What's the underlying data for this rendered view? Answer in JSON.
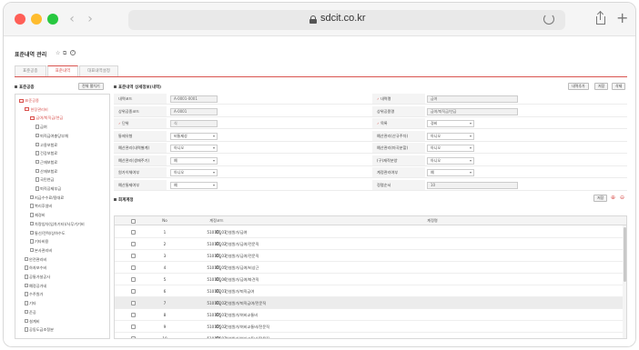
{
  "browser": {
    "url": "sdcit.co.kr",
    "back_glyph": "‹",
    "forward_glyph": "›",
    "new_tab_glyph": "+"
  },
  "page": {
    "title": "표준내역 관리",
    "star_icon": "☆",
    "open_icon": "⧉",
    "help_icon": "?",
    "tabs": [
      {
        "label": "표준공종",
        "active": false
      },
      {
        "label": "표준내역",
        "active": true
      },
      {
        "label": "대표내역설정",
        "active": false
      }
    ]
  },
  "left_panel": {
    "title": "표준공종",
    "expand_button": "전체 펼치기",
    "tree": [
      {
        "label": "표준공종",
        "level": 0,
        "type": "folder-open"
      },
      {
        "label": "현장관리비",
        "level": 1,
        "type": "folder-open"
      },
      {
        "label": "급여/퇴직금/연금",
        "level": 2,
        "type": "folder-open"
      },
      {
        "label": "급여",
        "level": 3,
        "type": "doc"
      },
      {
        "label": "퇴직급여충당부채",
        "level": 3,
        "type": "doc"
      },
      {
        "label": "고용보험료",
        "level": 3,
        "type": "doc"
      },
      {
        "label": "건강보험료",
        "level": 3,
        "type": "doc"
      },
      {
        "label": "근재보험료",
        "level": 3,
        "type": "doc"
      },
      {
        "label": "산재보험료",
        "level": 3,
        "type": "doc"
      },
      {
        "label": "국민연금",
        "level": 3,
        "type": "doc"
      },
      {
        "label": "퇴직공제부금",
        "level": 3,
        "type": "doc"
      },
      {
        "label": "지급수수료/용대료",
        "level": 2,
        "type": "doc"
      },
      {
        "label": "복리후생비",
        "level": 2,
        "type": "doc"
      },
      {
        "label": "제경비",
        "level": 2,
        "type": "doc"
      },
      {
        "label": "차량임차(임차기타)/사무기기비",
        "level": 2,
        "type": "doc"
      },
      {
        "label": "통신/전력/상하수도",
        "level": 2,
        "type": "doc"
      },
      {
        "label": "기타비용",
        "level": 2,
        "type": "doc"
      },
      {
        "label": "본사관리비",
        "level": 2,
        "type": "doc"
      },
      {
        "label": "안전관리비",
        "level": 1,
        "type": "doc"
      },
      {
        "label": "하자보수비",
        "level": 1,
        "type": "doc"
      },
      {
        "label": "공통가설공사",
        "level": 1,
        "type": "doc"
      },
      {
        "label": "예정공가네",
        "level": 1,
        "type": "doc"
      },
      {
        "label": "수주원가",
        "level": 1,
        "type": "doc"
      },
      {
        "label": "기타",
        "level": 1,
        "type": "doc"
      },
      {
        "label": "준공",
        "level": 1,
        "type": "doc"
      },
      {
        "label": "설계비",
        "level": 1,
        "type": "doc"
      },
      {
        "label": "공동도급조정분",
        "level": 1,
        "type": "doc"
      }
    ]
  },
  "detail": {
    "title": "표준내역 상세정보(내역)",
    "buttons": [
      "내역추가",
      "저장",
      "삭제"
    ],
    "rows": [
      [
        {
          "label": "내역코드",
          "value": "A-0001-0001",
          "kind": "ro"
        },
        {
          "label": "내역명",
          "value": "급여",
          "kind": "ro",
          "req": true
        }
      ],
      [
        {
          "label": "상위공종코드",
          "value": "A-0001",
          "kind": "ro"
        },
        {
          "label": "상위공종명",
          "value": "급여/퇴직금/연금",
          "kind": "ro"
        }
      ],
      [
        {
          "label": "단위",
          "value": "식",
          "kind": "ro",
          "req": true
        },
        {
          "label": "목록",
          "value": "경비",
          "kind": "sel",
          "req": true
        }
      ],
      [
        {
          "label": "통제유형",
          "value": "비통제성",
          "kind": "sel"
        },
        {
          "label": "예산관리(산규주차)",
          "value": "아니오",
          "kind": "sel"
        }
      ],
      [
        {
          "label": "예산관리(내역별계)",
          "value": "아니오",
          "kind": "sel"
        },
        {
          "label": "예산관리(마곡분할)",
          "value": "아니오",
          "kind": "sel"
        }
      ],
      [
        {
          "label": "예산관리(생애주기)",
          "value": "예",
          "kind": "sel"
        },
        {
          "label": "(구)재작분양",
          "value": "아니오",
          "kind": "sel"
        }
      ],
      [
        {
          "label": "원가이체여부",
          "value": "아니오",
          "kind": "sel"
        },
        {
          "label": "계정관리여부",
          "value": "예",
          "kind": "sel"
        }
      ],
      [
        {
          "label": "예산통제여부",
          "value": "예",
          "kind": "sel"
        },
        {
          "label": "정렬순서",
          "value": "10",
          "kind": "ro"
        }
      ]
    ]
  },
  "accounts": {
    "title": "회계계정",
    "buttons": [
      "저장"
    ],
    "plus_icon": "⊕",
    "minus_icon": "⊖",
    "columns": [
      "No",
      "계정코드",
      "계정명"
    ],
    "rows": [
      {
        "no": "1",
        "code": "51010101",
        "name": "건설원가/급여"
      },
      {
        "no": "2",
        "code": "51010102",
        "name": "건설원가/급여/전문직"
      },
      {
        "no": "3",
        "code": "51010103",
        "name": "건설원가/급여/전문직"
      },
      {
        "no": "4",
        "code": "51010105",
        "name": "건설원가/급여/비상근"
      },
      {
        "no": "5",
        "code": "51010106",
        "name": "건설원가/급여/파견직"
      },
      {
        "no": "6",
        "code": "51010201",
        "name": "건설원가/퇴직급여"
      },
      {
        "no": "7",
        "code": "51010202",
        "name": "건설원가/퇴직급여/전문직",
        "selected": true
      },
      {
        "no": "8",
        "code": "51010501",
        "name": "건설원가/여비교통비"
      },
      {
        "no": "9",
        "code": "51010502",
        "name": "건설원가/여비교통비/전문직"
      },
      {
        "no": "10",
        "code": "51010503",
        "name": "건설원가/여비교통비/전문직"
      }
    ]
  }
}
